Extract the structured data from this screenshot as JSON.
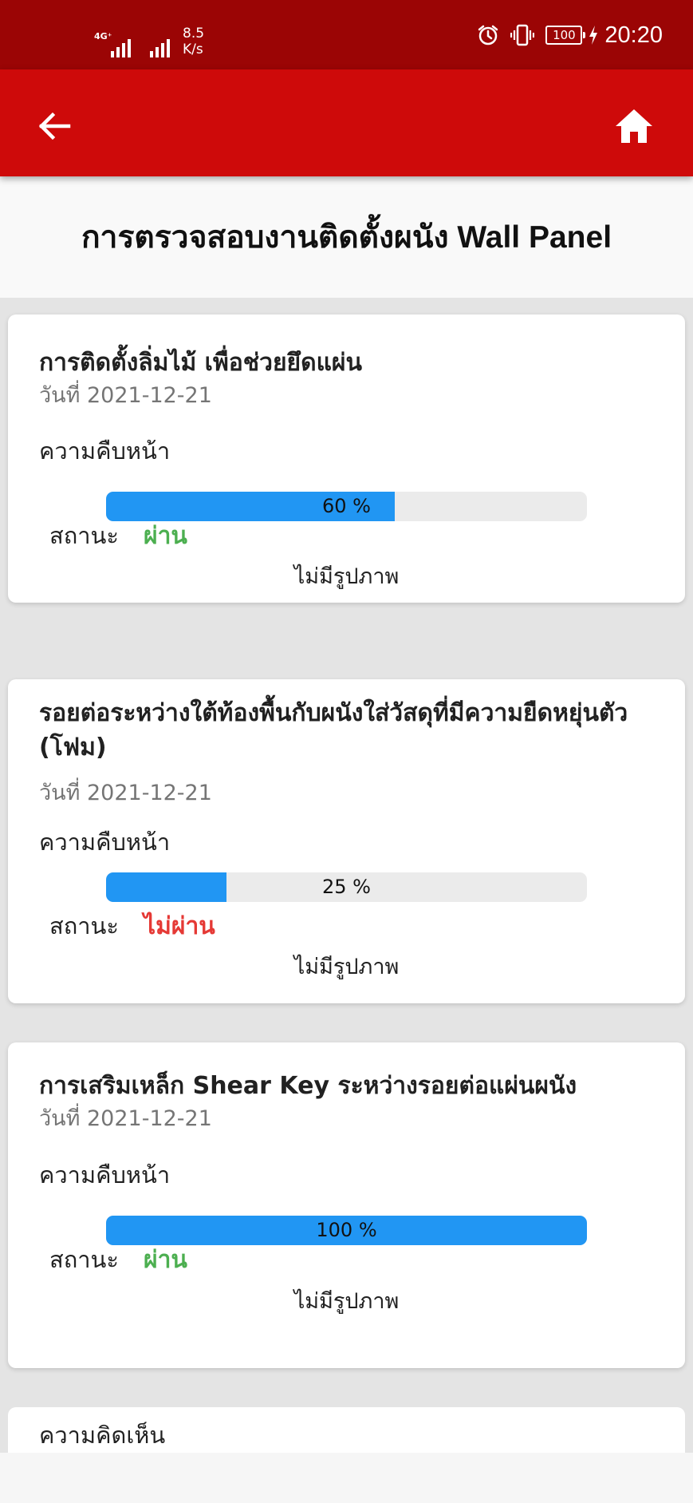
{
  "status_bar": {
    "network_type": "4G⁺",
    "network_speed": "8.5",
    "network_speed_unit": "K/s",
    "battery": "100",
    "time": "20:20"
  },
  "app_bar": {
    "back_icon": "arrow-left-icon",
    "home_icon": "home-icon",
    "background": "#ce0a0a"
  },
  "page": {
    "title": "การตรวจสอบงานติดตั้งผนัง Wall Panel"
  },
  "labels": {
    "date_prefix": "วันที่",
    "progress": "ความคืบหน้า",
    "status": "สถานะ",
    "no_image": "ไม่มีรูปภาพ",
    "comment": "ความคิดเห็น"
  },
  "items": [
    {
      "title": "การติดตั้งลิ่มไม้ เพื่อช่วยยึดแผ่น",
      "date": "วันที่ 2021-12-21",
      "progress_percent": 60,
      "progress_text": "60 %",
      "status": "ผ่าน",
      "status_color": "#4caf50"
    },
    {
      "title": "รอยต่อระหว่างใต้ท้องพื้นกับผนังใส่วัสดุที่มีความยืดหยุ่นตัว (โฟม)",
      "date": "วันที่ 2021-12-21",
      "progress_percent": 25,
      "progress_text": "25 %",
      "status": "ไม่ผ่าน",
      "status_color": "#e53935"
    },
    {
      "title": "การเสริมเหล็ก Shear Key ระหว่างรอยต่อแผ่นผนัง",
      "date": "วันที่ 2021-12-21",
      "progress_percent": 100,
      "progress_text": "100 %",
      "status": "ผ่าน",
      "status_color": "#4caf50"
    }
  ],
  "colors": {
    "status_bar": "#9b0505",
    "progress_fill": "#2196f3",
    "progress_track": "#ebebeb"
  }
}
